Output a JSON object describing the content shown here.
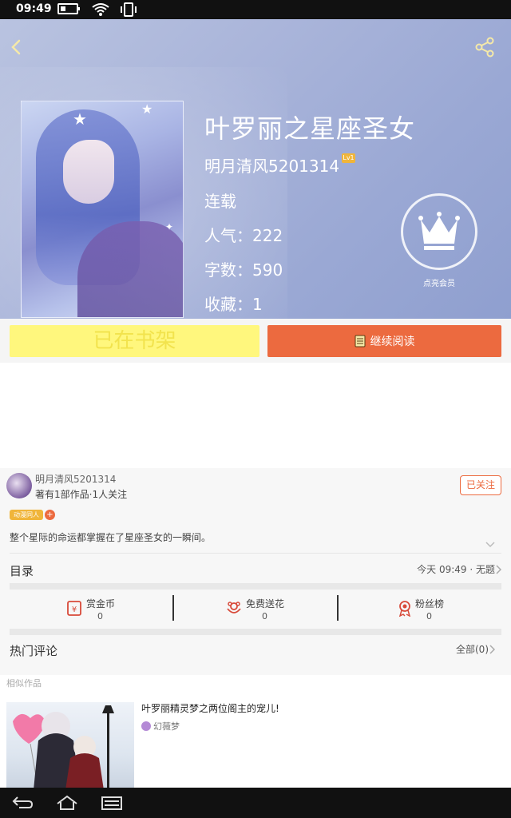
{
  "status_bar": {
    "time": "09:49"
  },
  "book": {
    "title": "叶罗丽之星座圣女",
    "author": "明月清风5201314",
    "author_level": "Lv1",
    "status": "连载",
    "popularity": "人气：222",
    "word_count": "字数：590",
    "favorites": "收藏：1",
    "vip_label": "点亮会员"
  },
  "actions": {
    "shelf_label": "已在书架",
    "read_label": "继续阅读"
  },
  "author_card": {
    "name": "明月清风5201314",
    "works": "著有1部作品·1人关注",
    "follow_label": "已关注",
    "tag": "动漫同人",
    "tag_plus": "+",
    "summary": "整个星际的命运都掌握在了星座圣女的一瞬间。"
  },
  "toc": {
    "label": "目录",
    "latest": "今天 09:49 · 无题"
  },
  "stats": [
    {
      "label": "赏金币",
      "value": "0"
    },
    {
      "label": "免费送花",
      "value": "0"
    },
    {
      "label": "粉丝榜",
      "value": "0"
    }
  ],
  "comments": {
    "label": "热门评论",
    "all": "全部(0)"
  },
  "similar": {
    "label": "相似作品",
    "title": "叶罗丽精灵梦之两位阁主的宠儿!",
    "author": "幻薇梦"
  },
  "colors": {
    "accent_orange": "#ec6a3f",
    "shelf_yellow": "#fff77d",
    "badge_gold": "#f0b53a"
  },
  "icons": [
    "back-icon",
    "share-icon",
    "crown-icon",
    "book-icon",
    "coin-icon",
    "flower-icon",
    "medal-icon",
    "chevron-right-icon",
    "chevron-down-icon",
    "nav-back-icon",
    "nav-home-icon",
    "nav-menu-icon"
  ]
}
